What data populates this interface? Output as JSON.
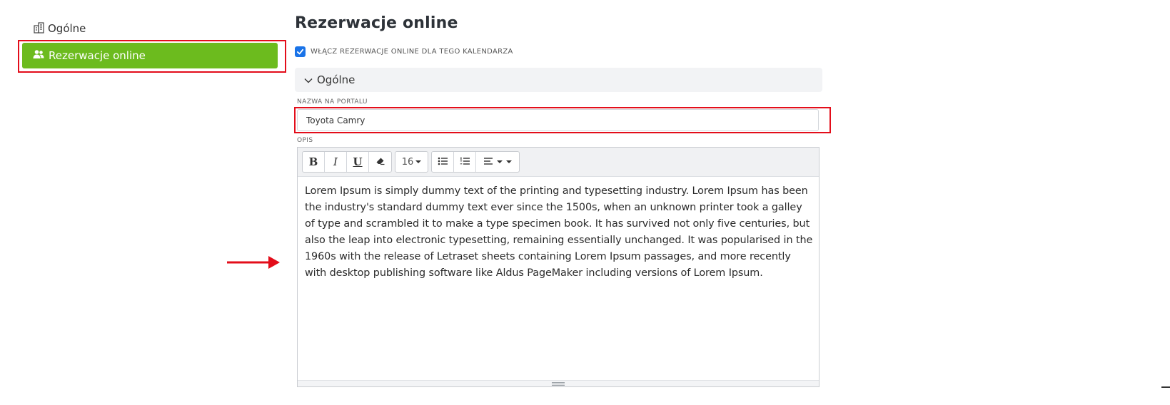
{
  "sidebar": {
    "items": [
      {
        "label": "Ogólne",
        "icon": "building-icon"
      },
      {
        "label": "Rezerwacje online",
        "icon": "users-icon",
        "active_color": "#6cbb1e"
      }
    ]
  },
  "main": {
    "title": "Rezerwacje online",
    "enable_checkbox": {
      "label": "WŁĄCZ REZERWACJE ONLINE DLA TEGO KALENDARZA",
      "checked": true
    },
    "section": {
      "label": "Ogólne",
      "icon": "chevron-down-icon"
    },
    "name_field": {
      "label": "NAZWA NA PORTALU",
      "value": "Toyota Camry"
    },
    "description": {
      "label": "OPIS",
      "toolbar": {
        "bold": "B",
        "italic": "I",
        "underline": "U",
        "eraser_icon": "eraser-icon",
        "font_size": "16",
        "unordered_list_icon": "bullet-list-icon",
        "ordered_list_icon": "numbered-list-icon",
        "align_icon": "align-left-icon"
      },
      "text": "Lorem Ipsum is simply dummy text of the printing and typesetting industry. Lorem Ipsum has been the industry's standard dummy text ever since the 1500s, when an unknown printer took a galley of type and scrambled it to make a type specimen book. It has survived not only five centuries, but also the leap into electronic typesetting, remaining essentially unchanged. It was popularised in the 1960s with the release of Letraset sheets containing Lorem Ipsum passages, and more recently with desktop publishing software like Aldus PageMaker including versions of Lorem Ipsum."
    }
  },
  "annotations": {
    "highlight_color": "#e30d1a"
  }
}
